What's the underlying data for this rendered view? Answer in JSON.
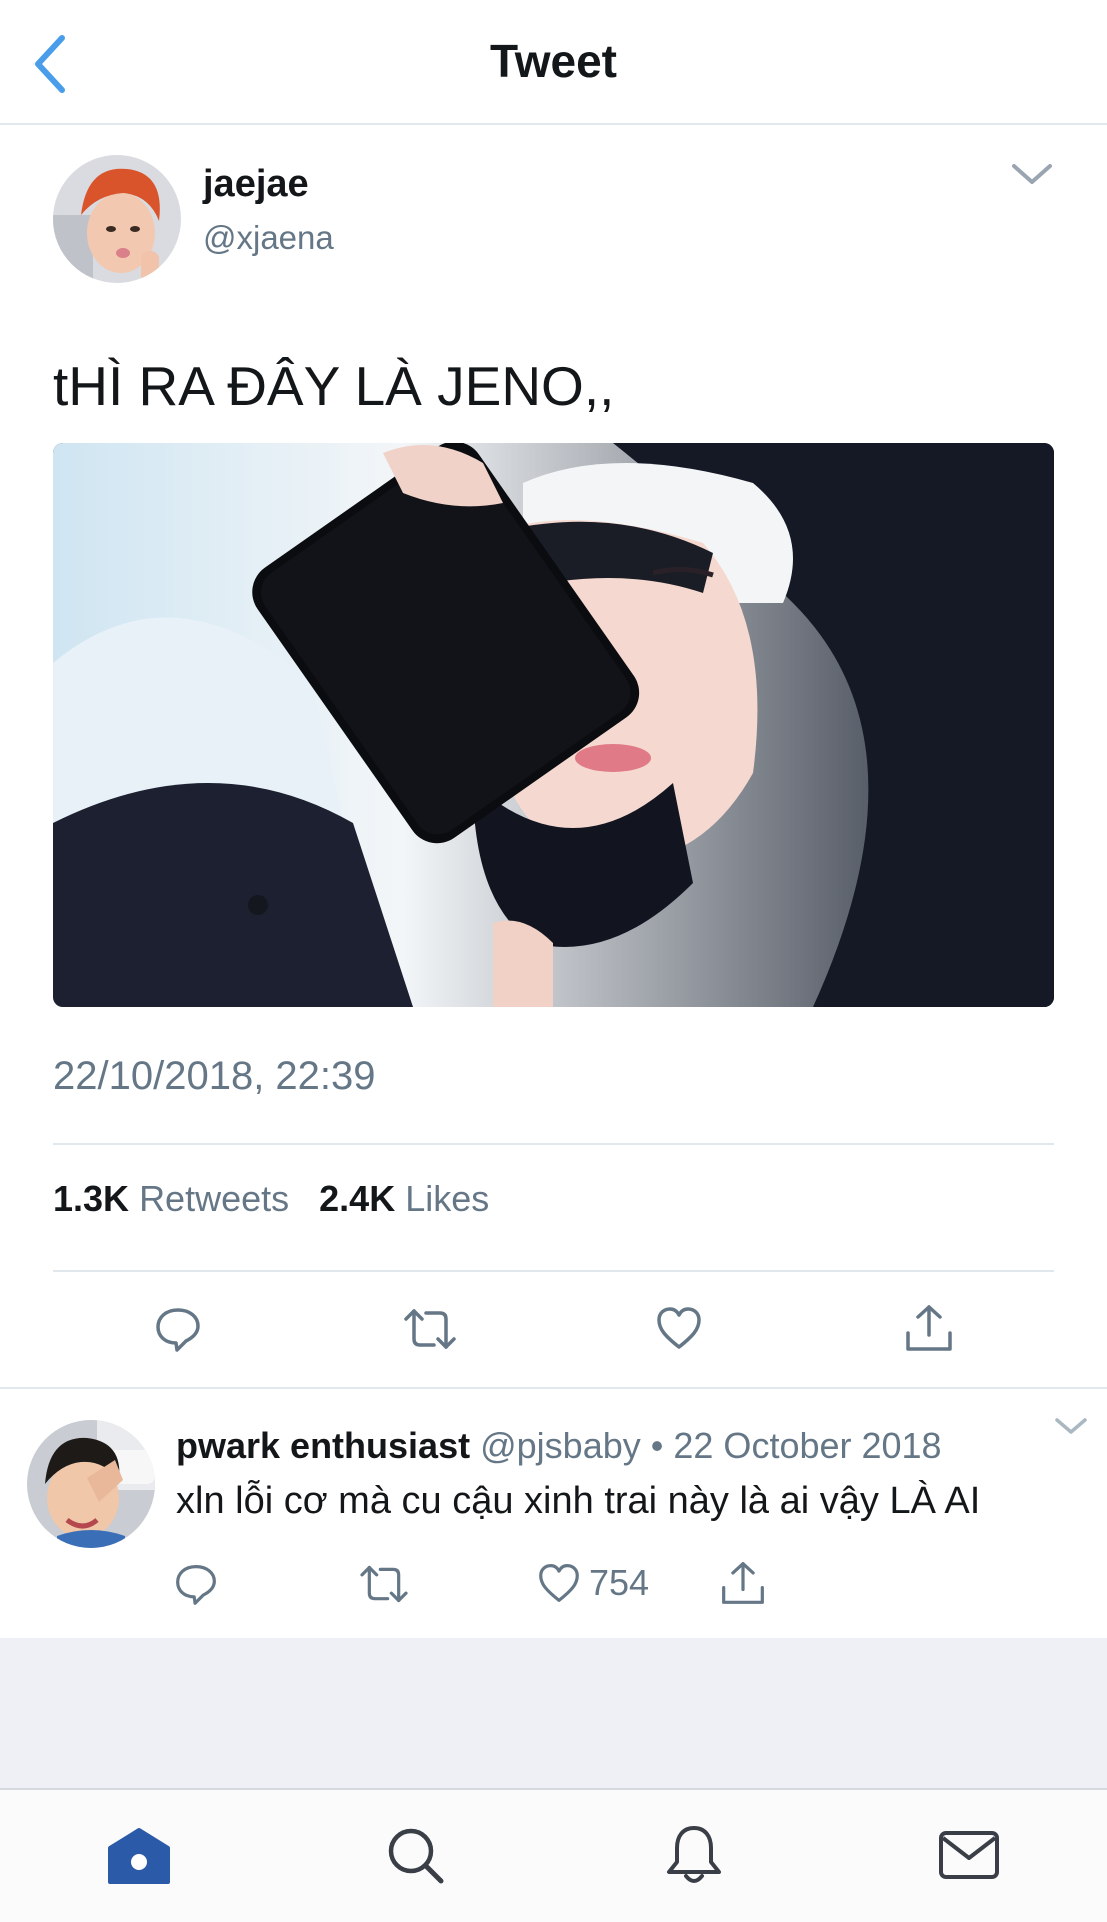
{
  "header": {
    "title": "Tweet",
    "back_icon": "chevron-left-icon"
  },
  "tweet": {
    "author_name": "jaejae",
    "author_handle": "@xjaena",
    "text": "tHÌ RA ĐÂY LÀ JENO,,",
    "timestamp": "22/10/2018, 22:39",
    "retweets_count": "1.3K",
    "retweets_label": "Retweets",
    "likes_count": "2.4K",
    "likes_label": "Likes",
    "menu_icon": "chevron-down-icon",
    "actions": [
      "reply-icon",
      "retweet-icon",
      "heart-icon",
      "share-icon"
    ]
  },
  "reply": {
    "author_name": "pwark enthusiast",
    "author_handle": "@pjsbaby",
    "separator": "•",
    "date": "22 October 2018",
    "text": "xln lỗi cơ mà cu cậu xinh trai này là ai vậy LÀ AI",
    "like_count": "754"
  },
  "tabbar": {
    "items": [
      "home-icon",
      "search-icon",
      "bell-icon",
      "mail-icon"
    ]
  },
  "colors": {
    "accent": "#4a9de9",
    "text": "#14171a",
    "secondary": "#657786",
    "divider": "#e1e8ed",
    "home_active": "#2a5aa8"
  }
}
